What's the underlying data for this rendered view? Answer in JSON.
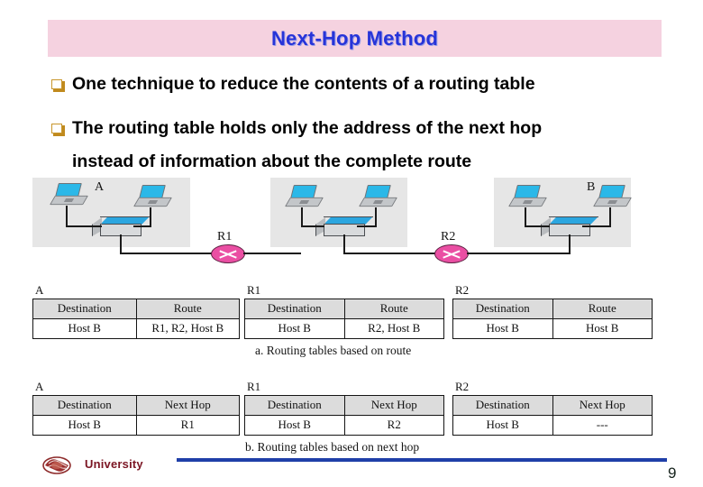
{
  "slide": {
    "title": "Next-Hop Method",
    "page_number": "9"
  },
  "bullets": [
    {
      "glyph": "square-bullet",
      "text": "One technique to reduce the contents of a routing table"
    },
    {
      "glyph": "square-bullet",
      "text": "The routing table holds only the address of the next hop"
    }
  ],
  "bullet_continuation": "instead of information about the complete route",
  "diagram": {
    "node_labels": {
      "host_a": "A",
      "host_b": "B",
      "router1": "R1",
      "router2": "R2"
    },
    "icons": {
      "laptop": "laptop-icon",
      "switch": "switch-icon",
      "router": "router-icon"
    }
  },
  "tables_route": {
    "caption": "a. Routing tables based on route",
    "tables": [
      {
        "label": "A",
        "headers": [
          "Destination",
          "Route"
        ],
        "rows": [
          [
            "Host B",
            "R1, R2, Host B"
          ]
        ]
      },
      {
        "label": "R1",
        "headers": [
          "Destination",
          "Route"
        ],
        "rows": [
          [
            "Host B",
            "R2, Host B"
          ]
        ]
      },
      {
        "label": "R2",
        "headers": [
          "Destination",
          "Route"
        ],
        "rows": [
          [
            "Host B",
            "Host B"
          ]
        ]
      }
    ]
  },
  "tables_nexthop": {
    "caption": "b. Routing tables based on next hop",
    "tables": [
      {
        "label": "A",
        "headers": [
          "Destination",
          "Next Hop"
        ],
        "rows": [
          [
            "Host B",
            "R1"
          ]
        ]
      },
      {
        "label": "R1",
        "headers": [
          "Destination",
          "Next Hop"
        ],
        "rows": [
          [
            "Host B",
            "R2"
          ]
        ]
      },
      {
        "label": "R2",
        "headers": [
          "Destination",
          "Next Hop"
        ],
        "rows": [
          [
            "Host B",
            "---"
          ]
        ]
      }
    ]
  },
  "footer": {
    "logo": "university-crest-logo",
    "university": "University"
  },
  "colors": {
    "title_band": "#f5d2e0",
    "title_text": "#2734d8",
    "bullet_glyph": "#c8962b",
    "router": "#ea4fa3",
    "switch_top": "#2ba6e0",
    "laptop_screen": "#2bb8e8",
    "lan_panel": "#e6e6e6",
    "table_header": "#dcdcdc",
    "footer_rule": "#1f3fa8",
    "university_text": "#7b1523"
  }
}
